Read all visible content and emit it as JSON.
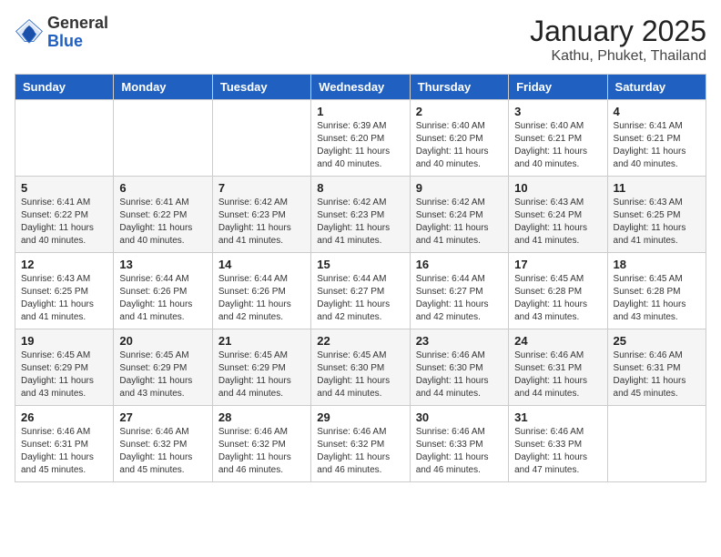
{
  "header": {
    "logo_general": "General",
    "logo_blue": "Blue",
    "month": "January 2025",
    "location": "Kathu, Phuket, Thailand"
  },
  "weekdays": [
    "Sunday",
    "Monday",
    "Tuesday",
    "Wednesday",
    "Thursday",
    "Friday",
    "Saturday"
  ],
  "weeks": [
    [
      {
        "day": "",
        "sunrise": "",
        "sunset": "",
        "daylight": ""
      },
      {
        "day": "",
        "sunrise": "",
        "sunset": "",
        "daylight": ""
      },
      {
        "day": "",
        "sunrise": "",
        "sunset": "",
        "daylight": ""
      },
      {
        "day": "1",
        "sunrise": "Sunrise: 6:39 AM",
        "sunset": "Sunset: 6:20 PM",
        "daylight": "Daylight: 11 hours and 40 minutes."
      },
      {
        "day": "2",
        "sunrise": "Sunrise: 6:40 AM",
        "sunset": "Sunset: 6:20 PM",
        "daylight": "Daylight: 11 hours and 40 minutes."
      },
      {
        "day": "3",
        "sunrise": "Sunrise: 6:40 AM",
        "sunset": "Sunset: 6:21 PM",
        "daylight": "Daylight: 11 hours and 40 minutes."
      },
      {
        "day": "4",
        "sunrise": "Sunrise: 6:41 AM",
        "sunset": "Sunset: 6:21 PM",
        "daylight": "Daylight: 11 hours and 40 minutes."
      }
    ],
    [
      {
        "day": "5",
        "sunrise": "Sunrise: 6:41 AM",
        "sunset": "Sunset: 6:22 PM",
        "daylight": "Daylight: 11 hours and 40 minutes."
      },
      {
        "day": "6",
        "sunrise": "Sunrise: 6:41 AM",
        "sunset": "Sunset: 6:22 PM",
        "daylight": "Daylight: 11 hours and 40 minutes."
      },
      {
        "day": "7",
        "sunrise": "Sunrise: 6:42 AM",
        "sunset": "Sunset: 6:23 PM",
        "daylight": "Daylight: 11 hours and 41 minutes."
      },
      {
        "day": "8",
        "sunrise": "Sunrise: 6:42 AM",
        "sunset": "Sunset: 6:23 PM",
        "daylight": "Daylight: 11 hours and 41 minutes."
      },
      {
        "day": "9",
        "sunrise": "Sunrise: 6:42 AM",
        "sunset": "Sunset: 6:24 PM",
        "daylight": "Daylight: 11 hours and 41 minutes."
      },
      {
        "day": "10",
        "sunrise": "Sunrise: 6:43 AM",
        "sunset": "Sunset: 6:24 PM",
        "daylight": "Daylight: 11 hours and 41 minutes."
      },
      {
        "day": "11",
        "sunrise": "Sunrise: 6:43 AM",
        "sunset": "Sunset: 6:25 PM",
        "daylight": "Daylight: 11 hours and 41 minutes."
      }
    ],
    [
      {
        "day": "12",
        "sunrise": "Sunrise: 6:43 AM",
        "sunset": "Sunset: 6:25 PM",
        "daylight": "Daylight: 11 hours and 41 minutes."
      },
      {
        "day": "13",
        "sunrise": "Sunrise: 6:44 AM",
        "sunset": "Sunset: 6:26 PM",
        "daylight": "Daylight: 11 hours and 41 minutes."
      },
      {
        "day": "14",
        "sunrise": "Sunrise: 6:44 AM",
        "sunset": "Sunset: 6:26 PM",
        "daylight": "Daylight: 11 hours and 42 minutes."
      },
      {
        "day": "15",
        "sunrise": "Sunrise: 6:44 AM",
        "sunset": "Sunset: 6:27 PM",
        "daylight": "Daylight: 11 hours and 42 minutes."
      },
      {
        "day": "16",
        "sunrise": "Sunrise: 6:44 AM",
        "sunset": "Sunset: 6:27 PM",
        "daylight": "Daylight: 11 hours and 42 minutes."
      },
      {
        "day": "17",
        "sunrise": "Sunrise: 6:45 AM",
        "sunset": "Sunset: 6:28 PM",
        "daylight": "Daylight: 11 hours and 43 minutes."
      },
      {
        "day": "18",
        "sunrise": "Sunrise: 6:45 AM",
        "sunset": "Sunset: 6:28 PM",
        "daylight": "Daylight: 11 hours and 43 minutes."
      }
    ],
    [
      {
        "day": "19",
        "sunrise": "Sunrise: 6:45 AM",
        "sunset": "Sunset: 6:29 PM",
        "daylight": "Daylight: 11 hours and 43 minutes."
      },
      {
        "day": "20",
        "sunrise": "Sunrise: 6:45 AM",
        "sunset": "Sunset: 6:29 PM",
        "daylight": "Daylight: 11 hours and 43 minutes."
      },
      {
        "day": "21",
        "sunrise": "Sunrise: 6:45 AM",
        "sunset": "Sunset: 6:29 PM",
        "daylight": "Daylight: 11 hours and 44 minutes."
      },
      {
        "day": "22",
        "sunrise": "Sunrise: 6:45 AM",
        "sunset": "Sunset: 6:30 PM",
        "daylight": "Daylight: 11 hours and 44 minutes."
      },
      {
        "day": "23",
        "sunrise": "Sunrise: 6:46 AM",
        "sunset": "Sunset: 6:30 PM",
        "daylight": "Daylight: 11 hours and 44 minutes."
      },
      {
        "day": "24",
        "sunrise": "Sunrise: 6:46 AM",
        "sunset": "Sunset: 6:31 PM",
        "daylight": "Daylight: 11 hours and 44 minutes."
      },
      {
        "day": "25",
        "sunrise": "Sunrise: 6:46 AM",
        "sunset": "Sunset: 6:31 PM",
        "daylight": "Daylight: 11 hours and 45 minutes."
      }
    ],
    [
      {
        "day": "26",
        "sunrise": "Sunrise: 6:46 AM",
        "sunset": "Sunset: 6:31 PM",
        "daylight": "Daylight: 11 hours and 45 minutes."
      },
      {
        "day": "27",
        "sunrise": "Sunrise: 6:46 AM",
        "sunset": "Sunset: 6:32 PM",
        "daylight": "Daylight: 11 hours and 45 minutes."
      },
      {
        "day": "28",
        "sunrise": "Sunrise: 6:46 AM",
        "sunset": "Sunset: 6:32 PM",
        "daylight": "Daylight: 11 hours and 46 minutes."
      },
      {
        "day": "29",
        "sunrise": "Sunrise: 6:46 AM",
        "sunset": "Sunset: 6:32 PM",
        "daylight": "Daylight: 11 hours and 46 minutes."
      },
      {
        "day": "30",
        "sunrise": "Sunrise: 6:46 AM",
        "sunset": "Sunset: 6:33 PM",
        "daylight": "Daylight: 11 hours and 46 minutes."
      },
      {
        "day": "31",
        "sunrise": "Sunrise: 6:46 AM",
        "sunset": "Sunset: 6:33 PM",
        "daylight": "Daylight: 11 hours and 47 minutes."
      },
      {
        "day": "",
        "sunrise": "",
        "sunset": "",
        "daylight": ""
      }
    ]
  ]
}
